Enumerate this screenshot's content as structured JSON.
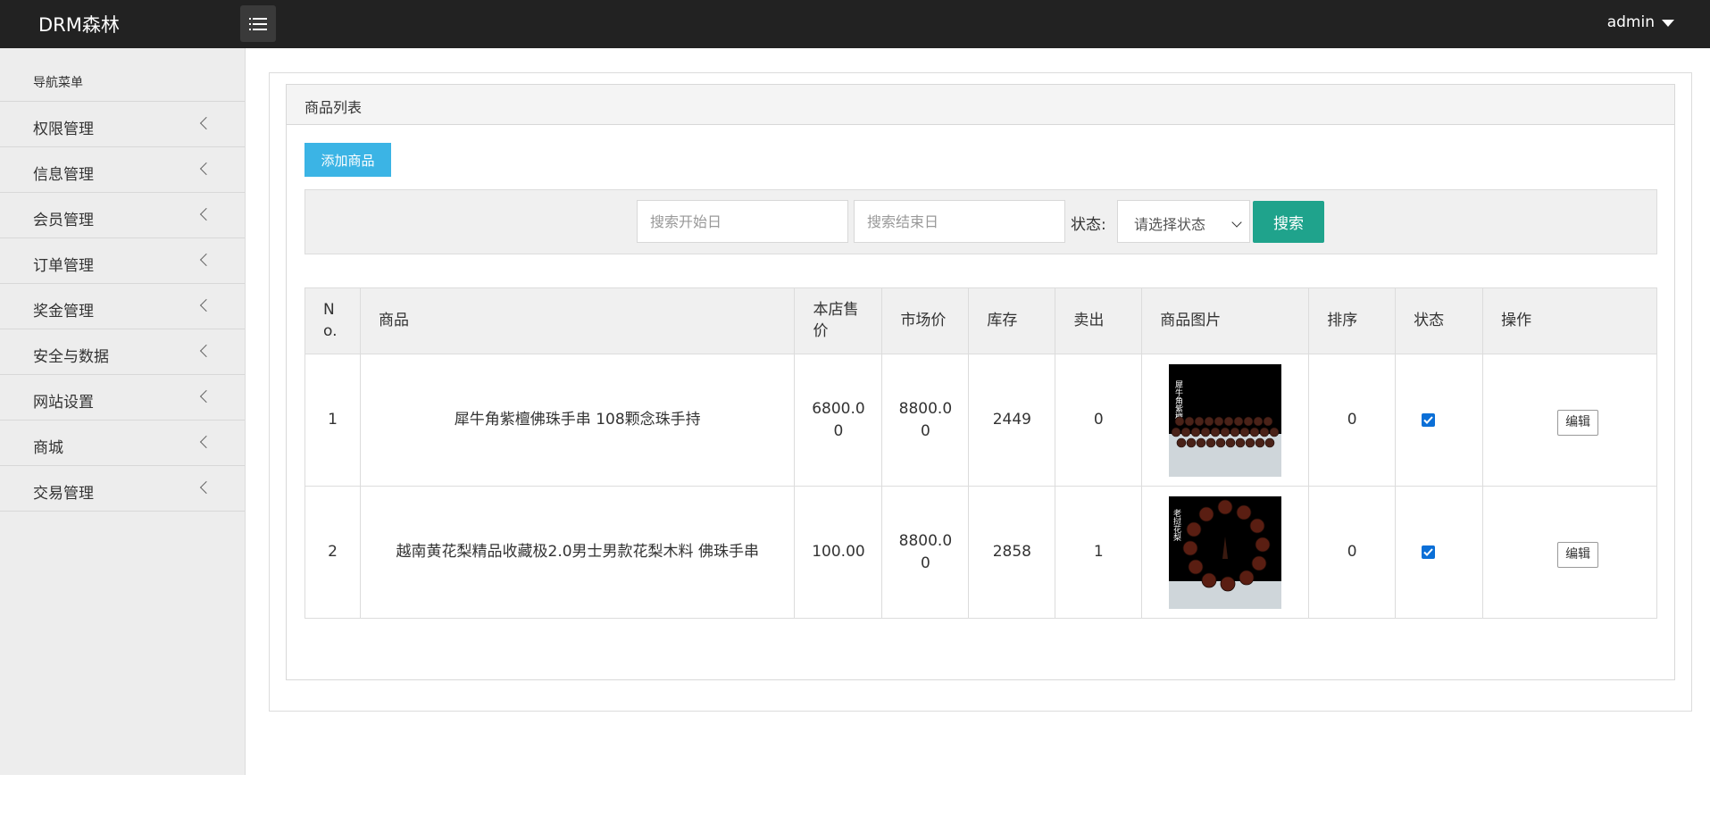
{
  "header": {
    "brand": "DRM森林",
    "user": "admin"
  },
  "sidebar": {
    "heading": "导航菜单",
    "items": [
      {
        "label": "权限管理"
      },
      {
        "label": "信息管理"
      },
      {
        "label": "会员管理"
      },
      {
        "label": "订单管理"
      },
      {
        "label": "奖金管理"
      },
      {
        "label": "安全与数据"
      },
      {
        "label": "网站设置"
      },
      {
        "label": "商城"
      },
      {
        "label": "交易管理"
      }
    ]
  },
  "main": {
    "panel_title": "商品列表",
    "add_button": "添加商品",
    "search": {
      "start_placeholder": "搜索开始日",
      "end_placeholder": "搜索结束日",
      "status_label": "状态:",
      "status_selected": "请选择状态",
      "search_button": "搜索"
    },
    "table": {
      "headers": [
        "No.",
        "商品",
        "本店售价",
        "市场价",
        "库存",
        "卖出",
        "商品图片",
        "排序",
        "状态",
        "操作"
      ],
      "header_no_line1": "N",
      "header_no_line2": "o.",
      "header_price_line1": "本店售",
      "header_price_line2": "价",
      "rows": [
        {
          "no": "1",
          "name": "犀牛角紫檀佛珠手串 108颗念珠手持",
          "price": "6800.00",
          "market": "8800.00",
          "stock": "2449",
          "sold": "0",
          "image_text": "犀牛角紫檀",
          "sort": "0",
          "status_checked": true,
          "action": "编辑"
        },
        {
          "no": "2",
          "name": "越南黄花梨精品收藏极2.0男士男款花梨木料 佛珠手串",
          "price": "100.00",
          "market": "8800.00",
          "stock": "2858",
          "sold": "1",
          "image_text": "老挝花梨",
          "sort": "0",
          "status_checked": true,
          "action": "编辑"
        }
      ]
    }
  },
  "colors": {
    "topbar": "#222222",
    "add_button": "#3bb4e5",
    "search_button": "#1fa38c",
    "checkbox": "#0b6fd7"
  }
}
